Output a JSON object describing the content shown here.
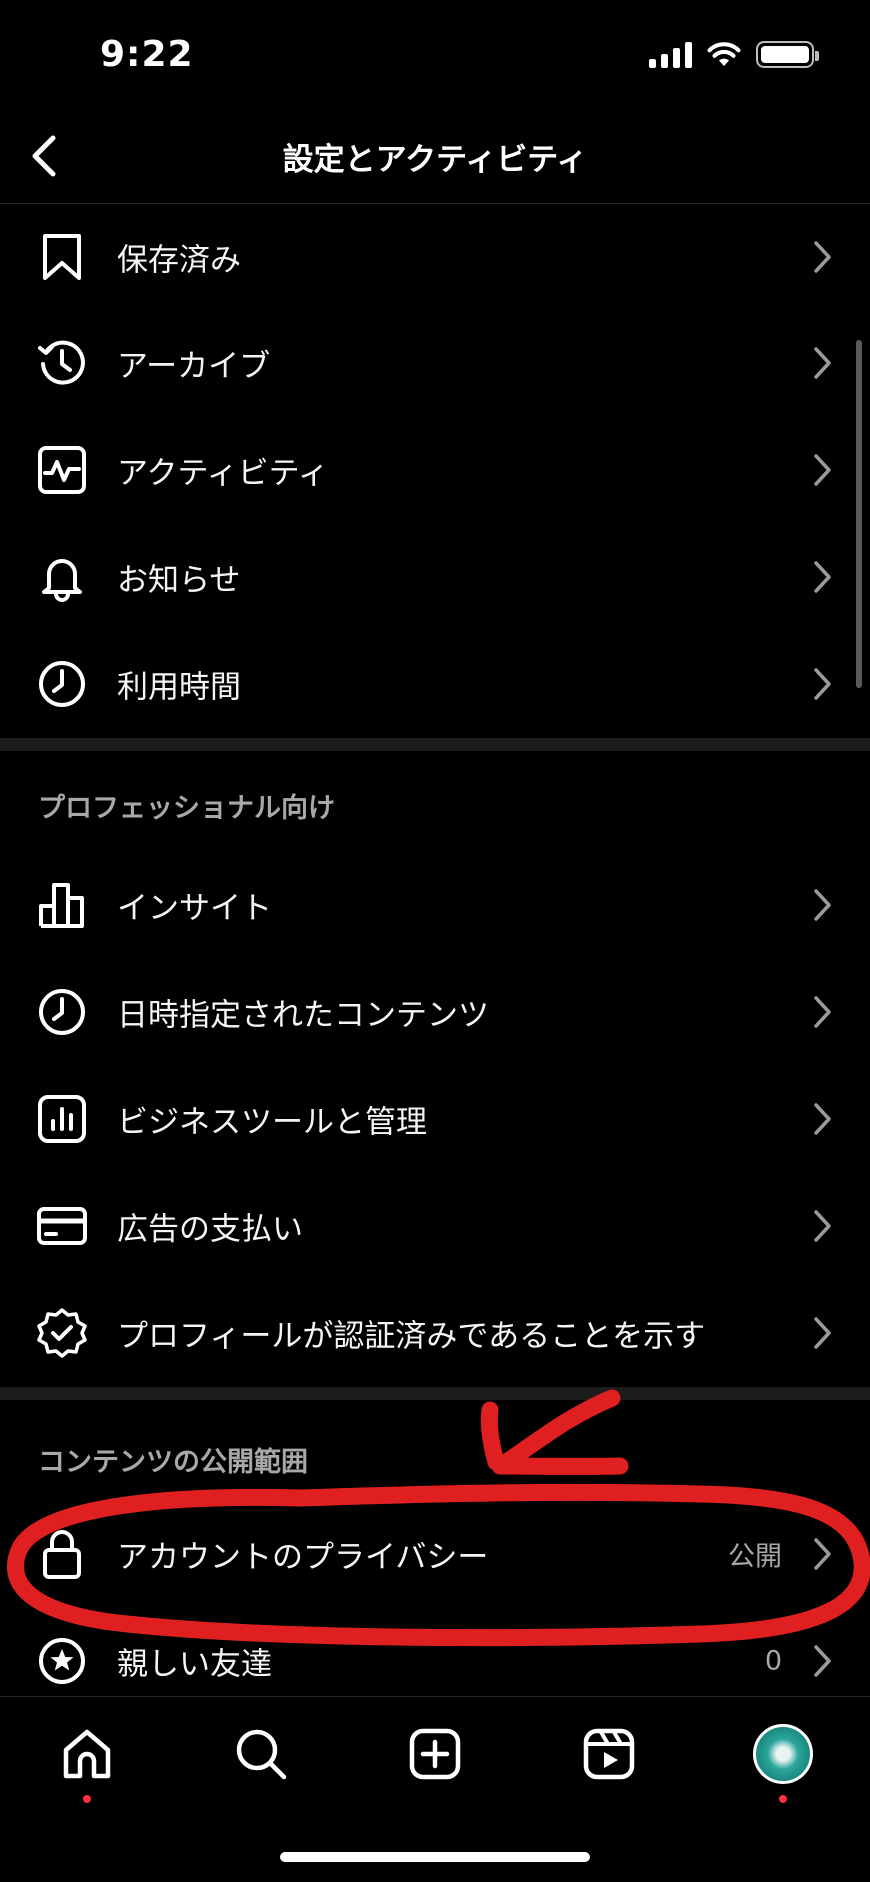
{
  "status": {
    "time": "9:22"
  },
  "header": {
    "title": "設定とアクティビティ"
  },
  "menu_top": [
    {
      "label": "保存済み",
      "icon": "bookmark-icon"
    },
    {
      "label": "アーカイブ",
      "icon": "archive-icon"
    },
    {
      "label": "アクティビティ",
      "icon": "activity-icon"
    },
    {
      "label": "お知らせ",
      "icon": "bell-icon"
    },
    {
      "label": "利用時間",
      "icon": "clock-icon"
    }
  ],
  "professional": {
    "title": "プロフェッショナル向け",
    "items": [
      {
        "label": "インサイト",
        "icon": "bar-chart-icon"
      },
      {
        "label": "日時指定されたコンテンツ",
        "icon": "clock-icon"
      },
      {
        "label": "ビジネスツールと管理",
        "icon": "business-tools-icon"
      },
      {
        "label": "広告の支払い",
        "icon": "credit-card-icon"
      },
      {
        "label": "プロフィールが認証済みであることを示す",
        "icon": "verified-badge-icon"
      }
    ]
  },
  "visibility": {
    "title": "コンテンツの公開範囲",
    "items": [
      {
        "label": "アカウントのプライバシー",
        "value": "公開",
        "icon": "lock-icon"
      },
      {
        "label": "親しい友達",
        "value": "0",
        "icon": "star-icon"
      }
    ]
  },
  "nav": [
    "home-icon",
    "search-icon",
    "create-icon",
    "reels-icon",
    "profile-avatar"
  ],
  "colors": {
    "background": "#000000",
    "annotation": "#e02020",
    "notification_dot": "#ff3040"
  }
}
